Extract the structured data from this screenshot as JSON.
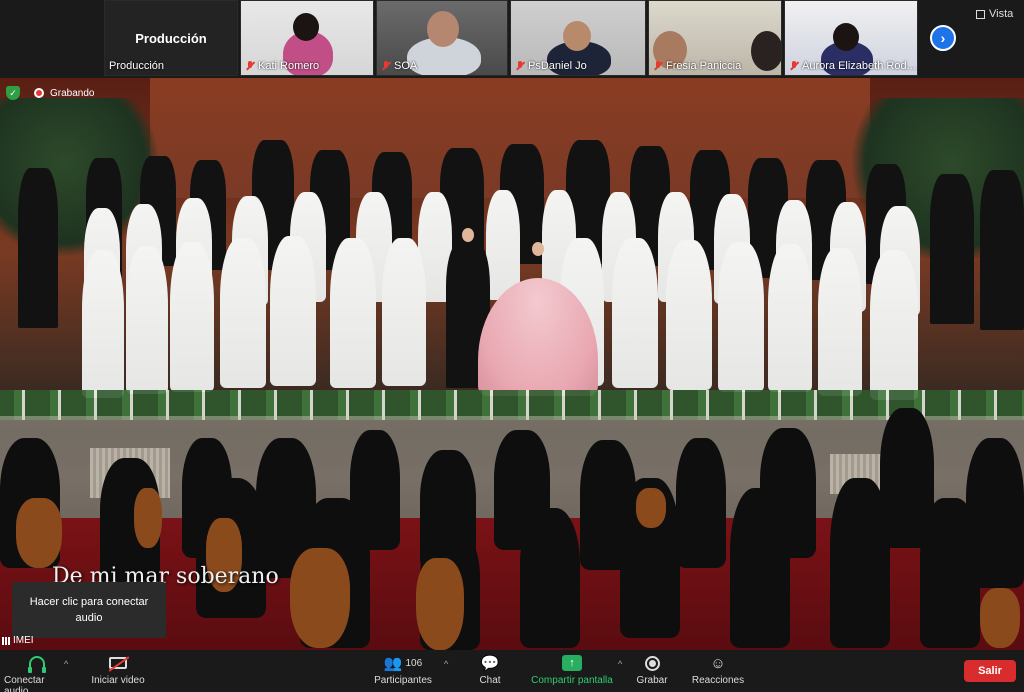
{
  "gallery": {
    "produccion_title": "Producción",
    "produccion_name": "Producción",
    "participants": [
      {
        "name": "Kati Romero"
      },
      {
        "name": "SOA"
      },
      {
        "name": "PsDaniel Jo"
      },
      {
        "name": "Fresia Paniccia"
      },
      {
        "name": "Aurora Elizabeth Rod..."
      }
    ],
    "view_label": "Vista",
    "next_icon": "chevron-right-icon"
  },
  "stage": {
    "recording_label": "Grabando",
    "caption": "De mi mar soberano"
  },
  "audio_tip": {
    "text": "Hacer clic para conectar audio"
  },
  "network_label": "IMEI",
  "toolbar": {
    "audio_label": "Conectar audio",
    "video_label": "Iniciar video",
    "participants_label": "Participantes",
    "participants_count": "106",
    "chat_label": "Chat",
    "share_label": "Compartir pantalla",
    "record_label": "Grabar",
    "reactions_label": "Reacciones",
    "leave_label": "Salir"
  },
  "colors": {
    "share": "#27ae60",
    "leave": "#d92c2c",
    "accent": "#1e73e8"
  }
}
